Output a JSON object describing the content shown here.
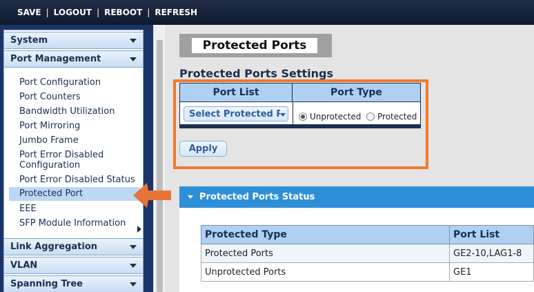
{
  "toolbar": {
    "save": "SAVE",
    "logout": "LOGOUT",
    "reboot": "REBOOT",
    "refresh": "REFRESH",
    "sep": "|"
  },
  "sidebar": {
    "sections": [
      {
        "label": "System"
      },
      {
        "label": "Port Management"
      },
      {
        "label": "Link Aggregation"
      },
      {
        "label": "VLAN"
      },
      {
        "label": "Spanning Tree"
      }
    ],
    "items": [
      "Port Configuration",
      "Port Counters",
      "Bandwidth Utilization",
      "Port Mirroring",
      "Jumbo Frame",
      "Port Error Disabled",
      "Configuration",
      "Port Error Disabled Status",
      "Protected Port",
      "EEE",
      "SFP Module Information"
    ],
    "active_item": "Protected Port"
  },
  "page": {
    "title": "Protected Ports",
    "settings_heading": "Protected Ports Settings"
  },
  "settings_table": {
    "col_port_list": "Port List",
    "col_port_type": "Port Type",
    "select_label": "Select Protected Ports",
    "radio_unprotected": "Unprotected",
    "radio_protected": "Protected",
    "selected_type": "Unprotected"
  },
  "apply_label": "Apply",
  "status_panel": {
    "title": "Protected Ports Status",
    "headers": [
      "Protected Type",
      "Port List"
    ],
    "rows": [
      [
        "Protected Ports",
        "GE2-10,LAG1-8"
      ],
      [
        "Unprotected Ports",
        "GE1"
      ]
    ]
  },
  "colors": {
    "highlight_border": "#f07a2b",
    "arrow": "#e8733a",
    "accent": "#2f8ed8",
    "header_bg": "#1a2f52"
  },
  "icons": [
    "chevron-down-icon",
    "chevron-right-icon",
    "left-arrow-icon",
    "triangle-down-icon"
  ]
}
